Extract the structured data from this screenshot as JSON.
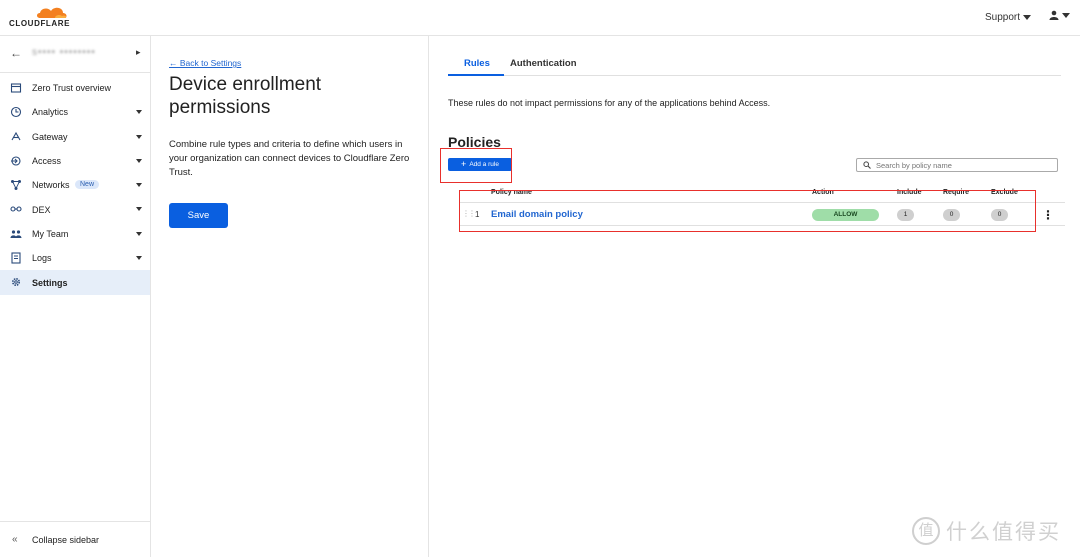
{
  "brand": {
    "logo_text": "CLOUDFLARE",
    "accent": "#f38020"
  },
  "topbar": {
    "support_label": "Support"
  },
  "sidebar": {
    "account_name": "ѕ•••• ••••••••",
    "items": [
      {
        "label": "Zero Trust overview",
        "icon": "home-icon",
        "has_chevron": false
      },
      {
        "label": "Analytics",
        "icon": "clock-icon",
        "has_chevron": true
      },
      {
        "label": "Gateway",
        "icon": "gateway-icon",
        "has_chevron": true
      },
      {
        "label": "Access",
        "icon": "access-icon",
        "has_chevron": true
      },
      {
        "label": "Networks",
        "icon": "networks-icon",
        "has_chevron": true,
        "badge": "New"
      },
      {
        "label": "DEX",
        "icon": "dex-icon",
        "has_chevron": true
      },
      {
        "label": "My Team",
        "icon": "team-icon",
        "has_chevron": true
      },
      {
        "label": "Logs",
        "icon": "logs-icon",
        "has_chevron": true
      },
      {
        "label": "Settings",
        "icon": "gear-icon",
        "has_chevron": false,
        "active": true
      }
    ],
    "collapse_label": "Collapse sidebar"
  },
  "middle": {
    "back_link": "← Back to Settings",
    "title": "Device enrollment permissions",
    "description": "Combine rule types and criteria to define which users in your organization can connect devices to Cloudflare Zero Trust.",
    "save_label": "Save"
  },
  "right": {
    "tabs": [
      {
        "label": "Rules",
        "active": true
      },
      {
        "label": "Authentication",
        "active": false
      }
    ],
    "info": "These rules do not impact permissions for any of the applications behind Access.",
    "policies_title": "Policies",
    "add_rule_label": "Add a rule",
    "search_placeholder": "Search by policy name",
    "table": {
      "columns": {
        "name": "Policy name",
        "action": "Action",
        "include": "Include",
        "require": "Require",
        "exclude": "Exclude"
      },
      "rows": [
        {
          "num": "1",
          "name": "Email domain policy",
          "action": "ALLOW",
          "include": "1",
          "require": "0",
          "exclude": "0"
        }
      ]
    }
  },
  "watermark": {
    "text": "什么值得买",
    "glyph": "值"
  },
  "colors": {
    "primary": "#0a5fe0",
    "link": "#2166d0",
    "allow": "#9fdda8",
    "highlight": "#e8302c"
  }
}
